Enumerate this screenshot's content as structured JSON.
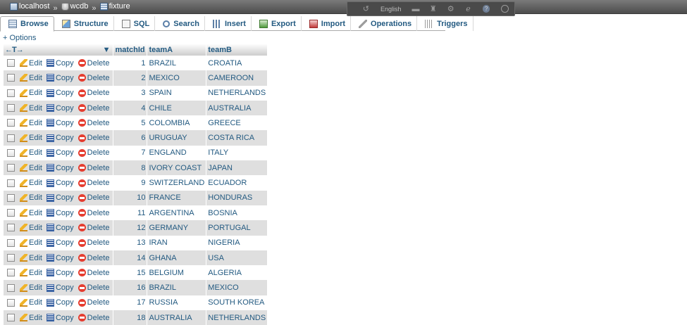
{
  "breadcrumbs": {
    "server": "localhost",
    "database": "wcdb",
    "table": "fixture",
    "separator": "»"
  },
  "toolbar": {
    "language": "English"
  },
  "tabs": [
    {
      "label": "Browse",
      "icon": "browse-icon"
    },
    {
      "label": "Structure",
      "icon": "structure-icon"
    },
    {
      "label": "SQL",
      "icon": "sql-icon"
    },
    {
      "label": "Search",
      "icon": "search-icon"
    },
    {
      "label": "Insert",
      "icon": "insert-icon"
    },
    {
      "label": "Export",
      "icon": "export-icon"
    },
    {
      "label": "Import",
      "icon": "import-icon"
    },
    {
      "label": "Operations",
      "icon": "operations-icon"
    },
    {
      "label": "Triggers",
      "icon": "triggers-icon"
    }
  ],
  "options_link": "+ Options",
  "table": {
    "arrows_label": "←T→",
    "sort_indicator": "▼",
    "columns": [
      "matchId",
      "teamA",
      "teamB"
    ],
    "row_actions": {
      "edit": "Edit",
      "copy": "Copy",
      "delete": "Delete"
    },
    "rows": [
      {
        "matchId": "1",
        "teamA": "BRAZIL",
        "teamB": "CROATIA"
      },
      {
        "matchId": "2",
        "teamA": "MEXICO",
        "teamB": "CAMEROON"
      },
      {
        "matchId": "3",
        "teamA": "SPAIN",
        "teamB": "NETHERLANDS"
      },
      {
        "matchId": "4",
        "teamA": "CHILE",
        "teamB": "AUSTRALIA"
      },
      {
        "matchId": "5",
        "teamA": "COLOMBIA",
        "teamB": "GREECE"
      },
      {
        "matchId": "6",
        "teamA": "URUGUAY",
        "teamB": "COSTA RICA"
      },
      {
        "matchId": "7",
        "teamA": "ENGLAND",
        "teamB": "ITALY"
      },
      {
        "matchId": "8",
        "teamA": "IVORY COAST",
        "teamB": "JAPAN"
      },
      {
        "matchId": "9",
        "teamA": "SWITZERLAND",
        "teamB": "ECUADOR"
      },
      {
        "matchId": "10",
        "teamA": "FRANCE",
        "teamB": "HONDURAS"
      },
      {
        "matchId": "11",
        "teamA": "ARGENTINA",
        "teamB": "BOSNIA"
      },
      {
        "matchId": "12",
        "teamA": "GERMANY",
        "teamB": "PORTUGAL"
      },
      {
        "matchId": "13",
        "teamA": "IRAN",
        "teamB": "NIGERIA"
      },
      {
        "matchId": "14",
        "teamA": "GHANA",
        "teamB": "USA"
      },
      {
        "matchId": "15",
        "teamA": "BELGIUM",
        "teamB": "ALGERIA"
      },
      {
        "matchId": "16",
        "teamA": "BRAZIL",
        "teamB": "MEXICO"
      },
      {
        "matchId": "17",
        "teamA": "RUSSIA",
        "teamB": "SOUTH KOREA"
      },
      {
        "matchId": "18",
        "teamA": "AUSTRALIA",
        "teamB": "NETHERLANDS"
      }
    ]
  },
  "colors": {
    "link": "#235a81",
    "row_alt": "#dfdfdf",
    "topbar": "#5a5a5a"
  }
}
